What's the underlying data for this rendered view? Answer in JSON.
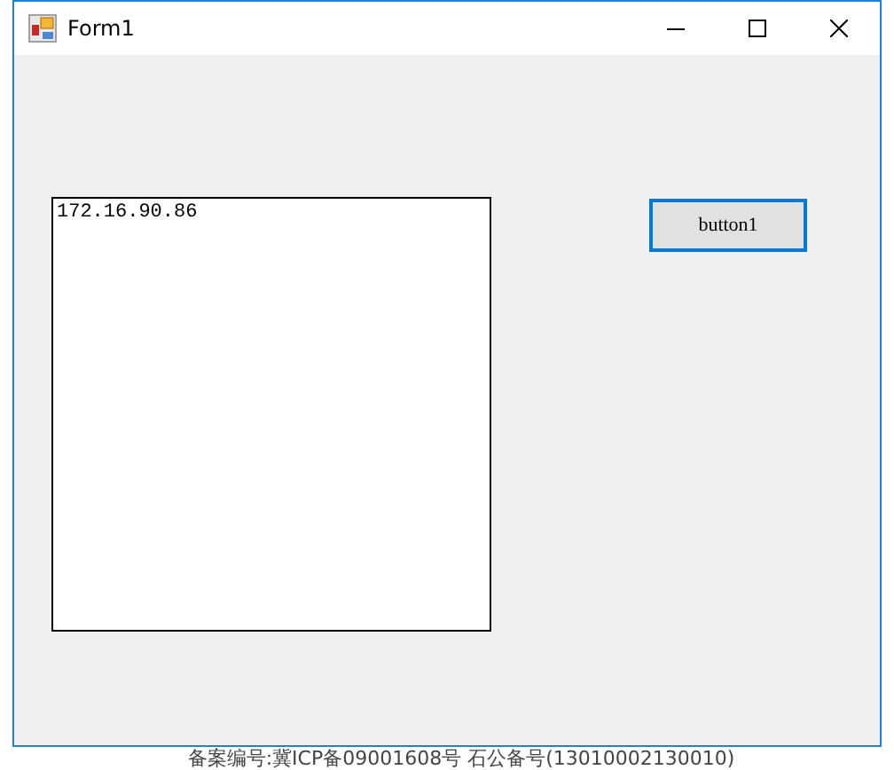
{
  "window": {
    "title": "Form1"
  },
  "textbox": {
    "value": "172.16.90.86"
  },
  "button": {
    "label": "button1",
    "focused": true
  },
  "footer": {
    "text": "备案编号:冀ICP备09001608号 石公备号(13010002130010)"
  }
}
